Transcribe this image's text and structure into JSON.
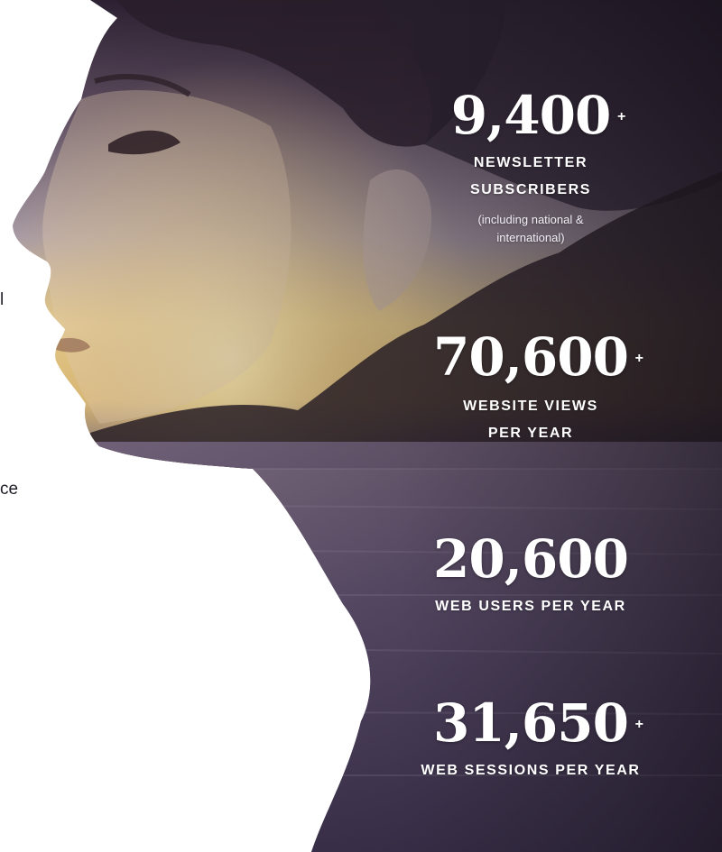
{
  "left_edge_text": {
    "fragment_1": "l",
    "fragment_2": "ce"
  },
  "stats": [
    {
      "number": "9,400",
      "plus": "+",
      "label_line_1": "NEWSLETTER",
      "label_line_2": "SUBSCRIBERS",
      "note": "(including national & international)"
    },
    {
      "number": "70,600",
      "plus": "+",
      "label_line_1": "WEBSITE VIEWS",
      "label_line_2": "PER YEAR"
    },
    {
      "number": "20,600",
      "label_line_1": "WEB USERS PER YEAR"
    },
    {
      "number": "31,650",
      "plus": "+",
      "label_line_1": "WEB SESSIONS PER YEAR"
    }
  ],
  "colors": {
    "background": "#ffffff",
    "stat_text": "#ffffff",
    "sky_purple": "#5a4766",
    "sunset_gold": "#e7c77f",
    "sea_dark": "#3b3048"
  }
}
